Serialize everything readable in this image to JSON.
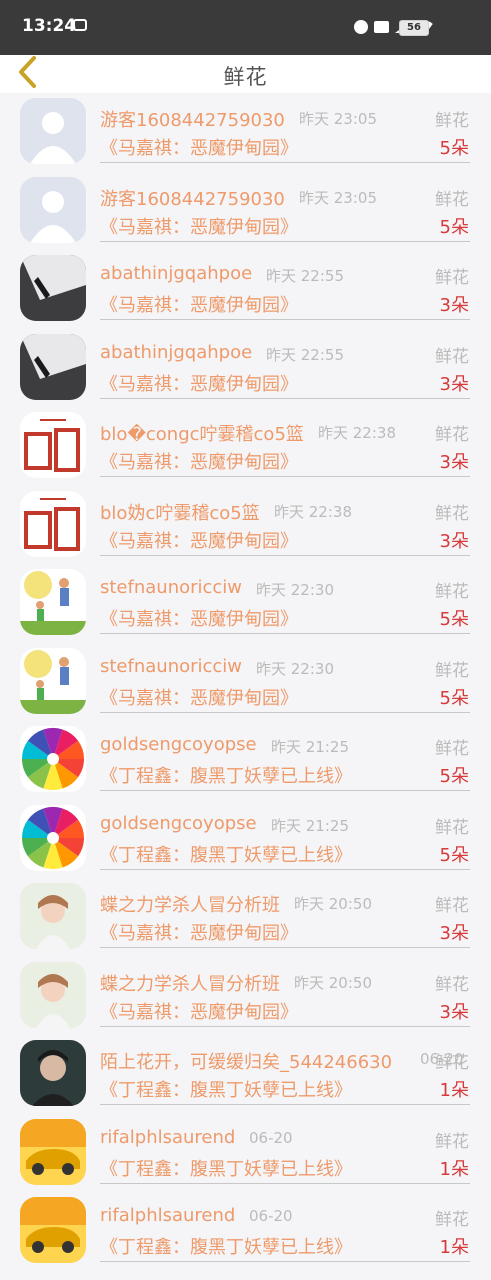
{
  "status_bar": {
    "time": "13:24",
    "battery": "56",
    "icons": [
      "alarm-icon",
      "hd-icon",
      "signal-5g-icon",
      "wifi-icon",
      "battery-icon"
    ]
  },
  "header": {
    "title": "鲜花",
    "back_icon": "chevron-left-icon",
    "accent_color": "#c9a227"
  },
  "rows": [
    {
      "user": "游客1608442759030",
      "time": "昨天 23:05",
      "type": "鲜花",
      "show": "《马嘉祺：恶魔伊甸园》",
      "count": "5朵",
      "avatar": "default"
    },
    {
      "user": "游客1608442759030",
      "time": "昨天 23:05",
      "type": "鲜花",
      "show": "《马嘉祺：恶魔伊甸园》",
      "count": "5朵",
      "avatar": "default"
    },
    {
      "user": "abathinjgqahpoe",
      "time": "昨天 22:55",
      "type": "鲜花",
      "show": "《马嘉祺：恶魔伊甸园》",
      "count": "3朵",
      "avatar": "dark"
    },
    {
      "user": "abathinjgqahpoe",
      "time": "昨天 22:55",
      "type": "鲜花",
      "show": "《马嘉祺：恶魔伊甸园》",
      "count": "3朵",
      "avatar": "dark"
    },
    {
      "user": "blo�congc咛霎稽co5篮",
      "time": "昨天 22:38",
      "type": "鲜花",
      "show": "《马嘉祺：恶魔伊甸园》",
      "count": "3朵",
      "avatar": "calligraphy"
    },
    {
      "user": "blo妫c咛霎稽co5篮",
      "time": "昨天 22:38",
      "type": "鲜花",
      "show": "《马嘉祺：恶魔伊甸园》",
      "count": "3朵",
      "avatar": "calligraphy"
    },
    {
      "user": "stefnaunoricciw",
      "time": "昨天 22:30",
      "type": "鲜花",
      "show": "《马嘉祺：恶魔伊甸园》",
      "count": "5朵",
      "avatar": "family"
    },
    {
      "user": "stefnaunoricciw",
      "time": "昨天 22:30",
      "type": "鲜花",
      "show": "《马嘉祺：恶魔伊甸园》",
      "count": "5朵",
      "avatar": "family"
    },
    {
      "user": "goldsengcoyopse",
      "time": "昨天 21:25",
      "type": "鲜花",
      "show": "《丁程鑫：腹黑丁妖孽已上线》",
      "count": "5朵",
      "avatar": "colorwheel"
    },
    {
      "user": "goldsengcoyopse",
      "time": "昨天 21:25",
      "type": "鲜花",
      "show": "《丁程鑫：腹黑丁妖孽已上线》",
      "count": "5朵",
      "avatar": "colorwheel"
    },
    {
      "user": "蝶之力学杀人冒分析班",
      "time": "昨天 20:50",
      "type": "鲜花",
      "show": "《马嘉祺：恶魔伊甸园》",
      "count": "3朵",
      "avatar": "girl"
    },
    {
      "user": "蝶之力学杀人冒分析班",
      "time": "昨天 20:50",
      "type": "鲜花",
      "show": "《马嘉祺：恶魔伊甸园》",
      "count": "3朵",
      "avatar": "girl"
    },
    {
      "user": "陌上花开，可缓缓归矣_544246630",
      "time": "06-20",
      "type": "鲜花",
      "show": "《丁程鑫：腹黑丁妖孽已上线》",
      "count": "1朵",
      "avatar": "portrait"
    },
    {
      "user": "rifalphlsaurend",
      "time": "06-20",
      "type": "鲜花",
      "show": "《丁程鑫：腹黑丁妖孽已上线》",
      "count": "1朵",
      "avatar": "car"
    },
    {
      "user": "rifalphlsaurend",
      "time": "06-20",
      "type": "鲜花",
      "show": "《丁程鑫：腹黑丁妖孽已上线》",
      "count": "1朵",
      "avatar": "car"
    }
  ]
}
